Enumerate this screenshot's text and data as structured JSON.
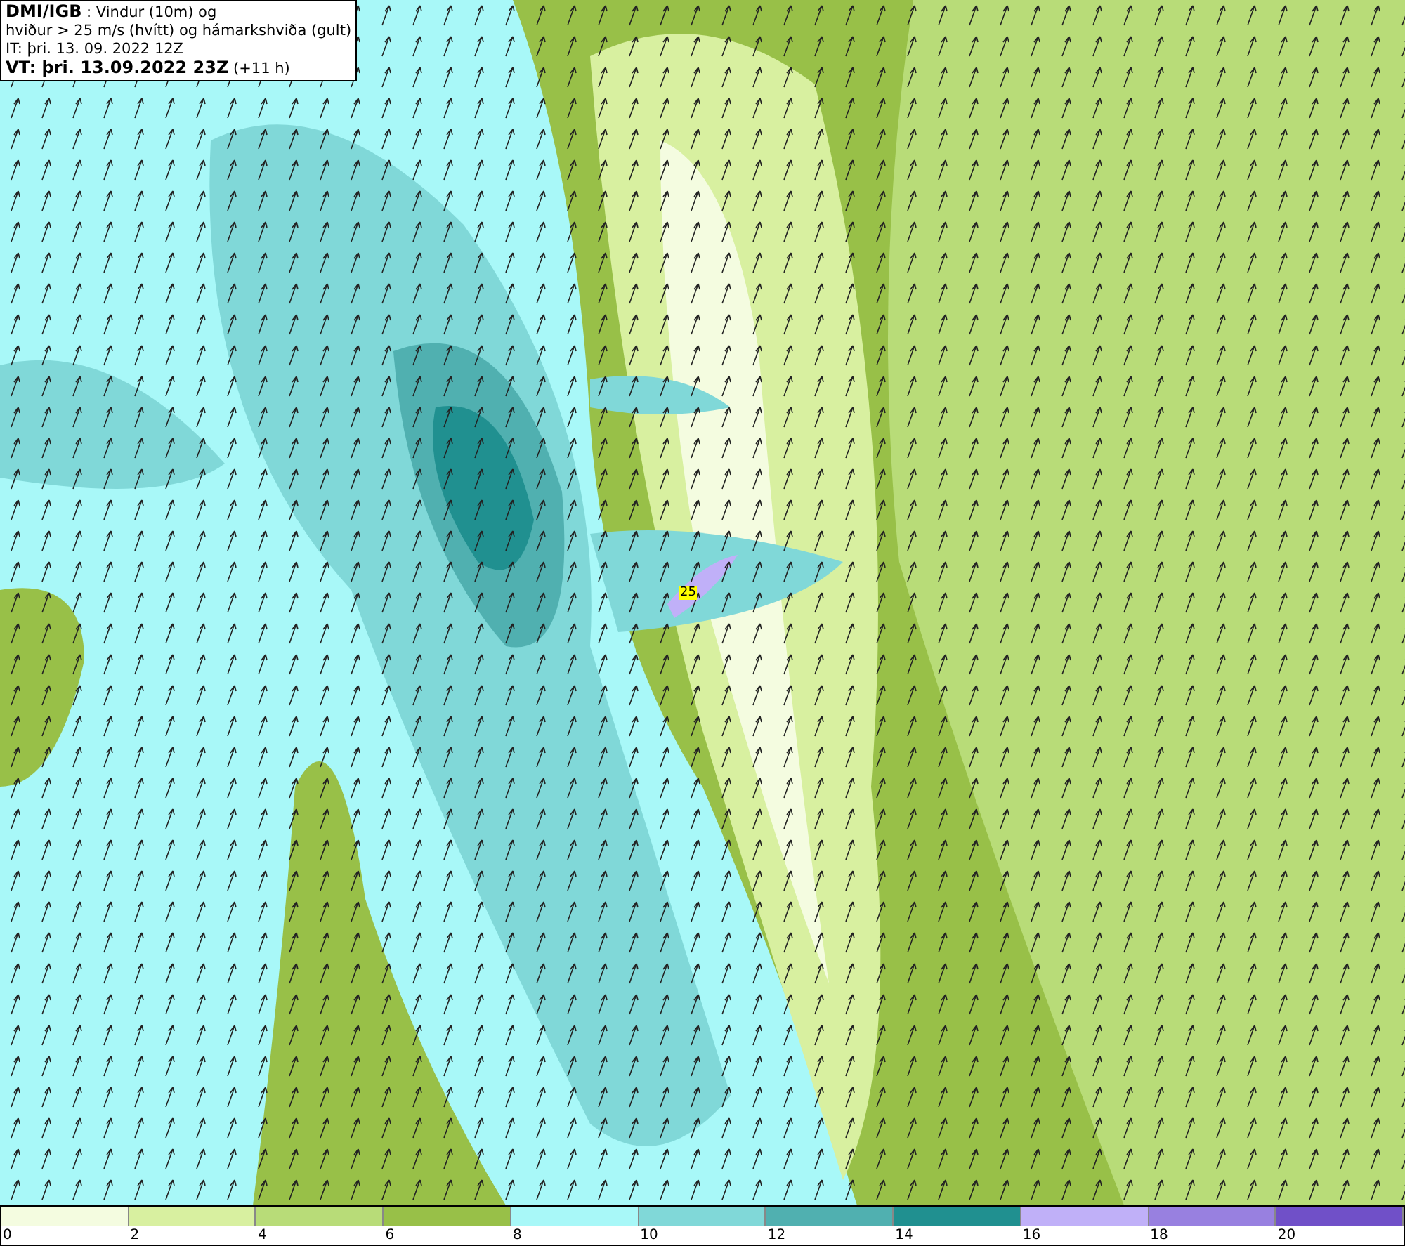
{
  "header": {
    "lines": [
      "**DMI/IGB** : Vindur (10m) og",
      "hviður > 25 m/s (hvítt) og hámarkshviða (gult)",
      "IT: þri. 13. 09. 2022 12Z",
      "**VT: þri. 13.09.2022 23Z** (+11 h)"
    ]
  },
  "map": {
    "gust_label": "25"
  },
  "legend": {
    "swatches": [
      {
        "color": "#f4fce0"
      },
      {
        "color": "#d8f0a0"
      },
      {
        "color": "#b8dc78"
      },
      {
        "color": "#98c048"
      },
      {
        "color": "#a8f8f8"
      },
      {
        "color": "#80d8d8"
      },
      {
        "color": "#50b0b0"
      },
      {
        "color": "#209090"
      },
      {
        "color": "#c0b0f8"
      },
      {
        "color": "#9880e0"
      },
      {
        "color": "#7050c8"
      }
    ],
    "ticks": [
      "0",
      "2",
      "4",
      "6",
      "8",
      "10",
      "12",
      "14",
      "16",
      "18",
      "20"
    ]
  }
}
